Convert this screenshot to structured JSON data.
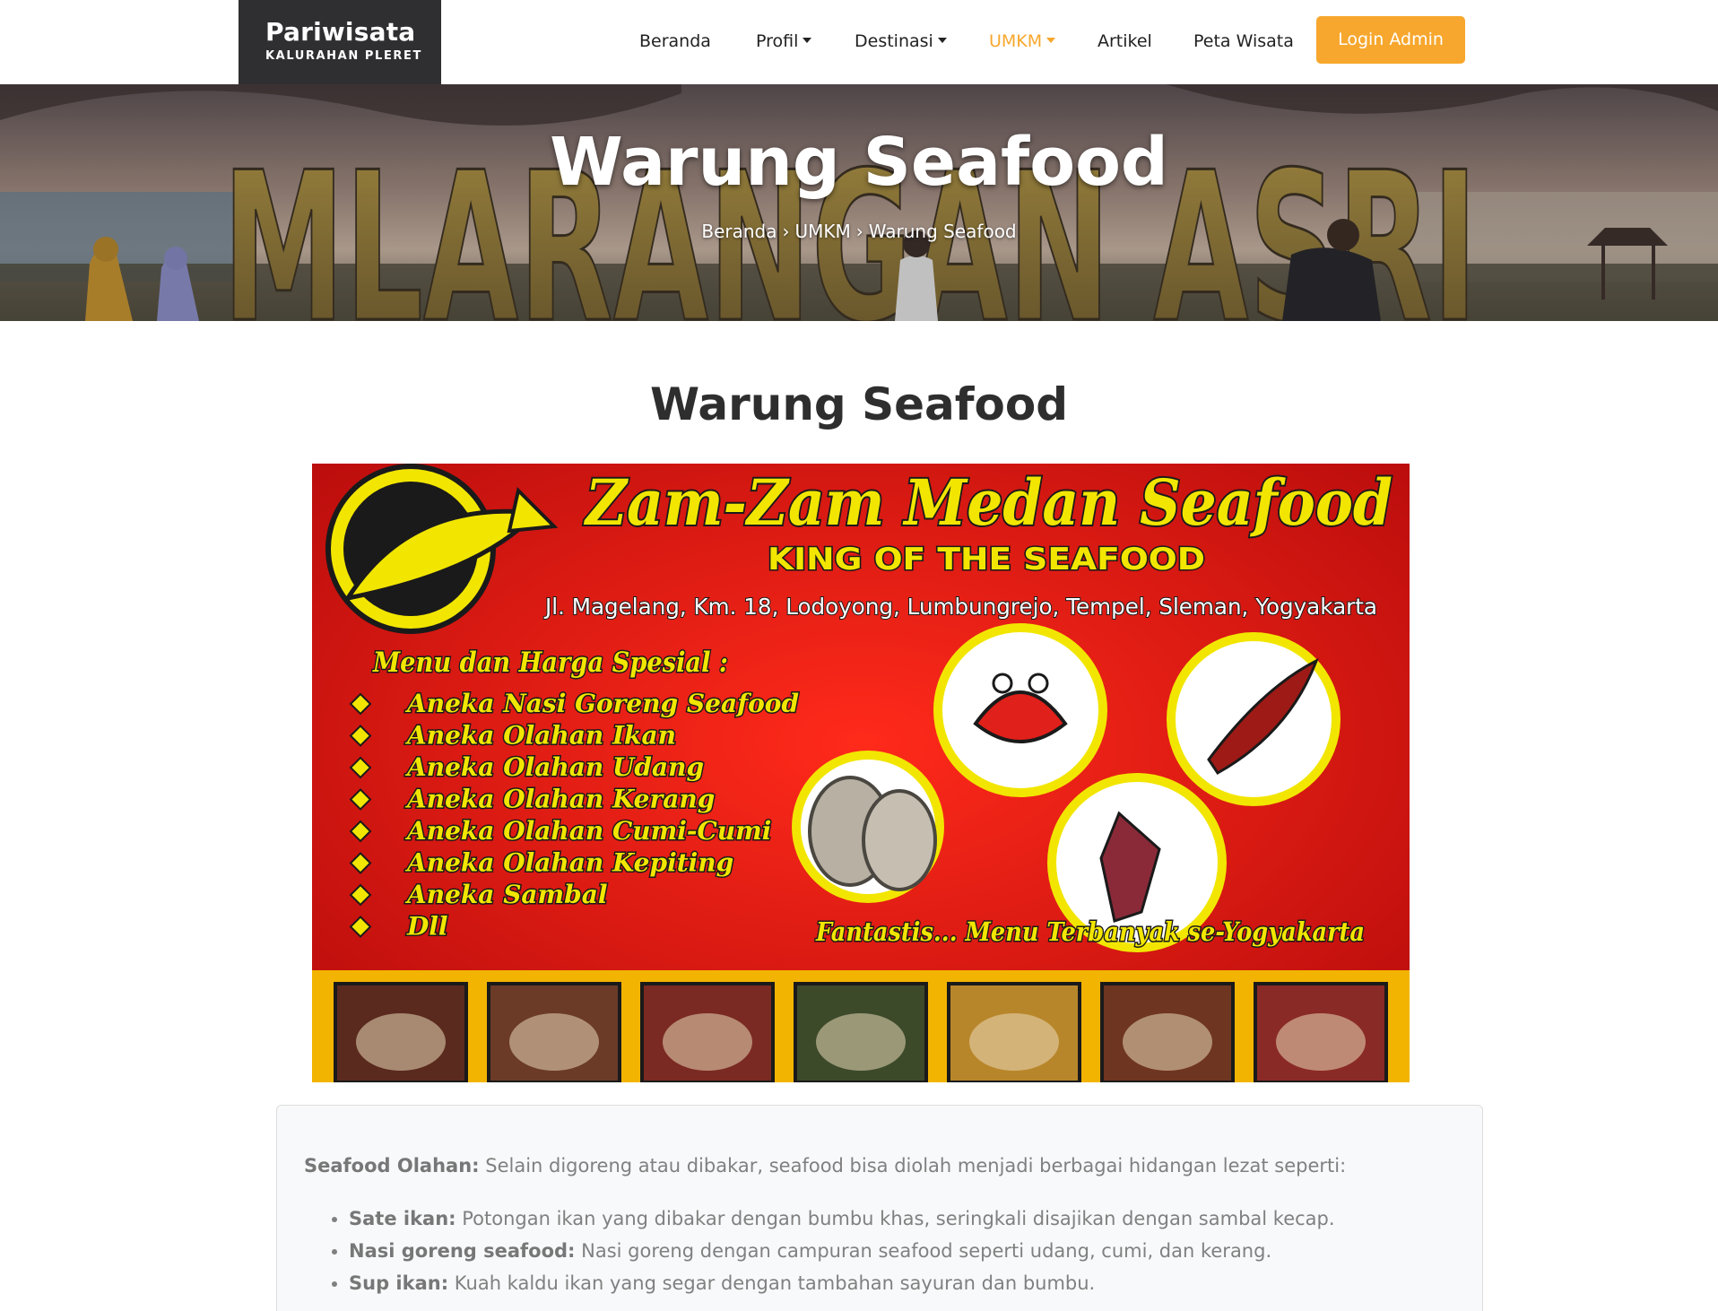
{
  "navbar": {
    "brand_title": "Pariwisata",
    "brand_subtitle": "KALURAHAN PLERET",
    "items": [
      {
        "label": "Beranda",
        "dropdown": false,
        "active": false
      },
      {
        "label": "Profil",
        "dropdown": true,
        "active": false
      },
      {
        "label": "Destinasi",
        "dropdown": true,
        "active": false
      },
      {
        "label": "UMKM",
        "dropdown": true,
        "active": true
      },
      {
        "label": "Artikel",
        "dropdown": false,
        "active": false
      },
      {
        "label": "Peta Wisata",
        "dropdown": false,
        "active": false
      }
    ],
    "login_label": "Login Admin"
  },
  "hero": {
    "title": "Warung Seafood",
    "sign_text": "MLARANGAN ASRI",
    "breadcrumb": [
      "Beranda",
      "UMKM",
      "Warung Seafood"
    ]
  },
  "main": {
    "title": "Warung Seafood"
  },
  "banner": {
    "heading": "Zam-Zam Medan Seafood",
    "tagline": "KING OF THE SEAFOOD",
    "address": "Jl. Magelang, Km. 18, Lodoyong, Lumbungrejo, Tempel, Sleman, Yogyakarta",
    "menu_title": "Menu dan Harga Spesial :",
    "menu_items": [
      "Aneka Nasi Goreng Seafood",
      "Aneka Olahan Ikan",
      "Aneka Olahan Udang",
      "Aneka Olahan Kerang",
      "Aneka Olahan Cumi-Cumi",
      "Aneka Olahan Kepiting",
      "Aneka Sambal",
      "Dll"
    ],
    "footer_slogan": "Fantastis... Menu Terbanyak se-Yogyakarta"
  },
  "card": {
    "intro_bold": "Seafood Olahan:",
    "intro_text": " Selain digoreng atau dibakar, seafood bisa diolah menjadi berbagai hidangan lezat seperti:",
    "items": [
      {
        "bold": "Sate ikan:",
        "text": " Potongan ikan yang dibakar dengan bumbu khas, seringkali disajikan dengan sambal kecap."
      },
      {
        "bold": "Nasi goreng seafood:",
        "text": " Nasi goreng dengan campuran seafood seperti udang, cumi, dan kerang."
      },
      {
        "bold": "Sup ikan:",
        "text": " Kuah kaldu ikan yang segar dengan tambahan sayuran dan bumbu."
      }
    ]
  },
  "colors": {
    "accent": "#f7a72d",
    "brand_bg": "#2f2f32",
    "banner_red": "#d81414",
    "banner_yellow": "#f2e600"
  }
}
